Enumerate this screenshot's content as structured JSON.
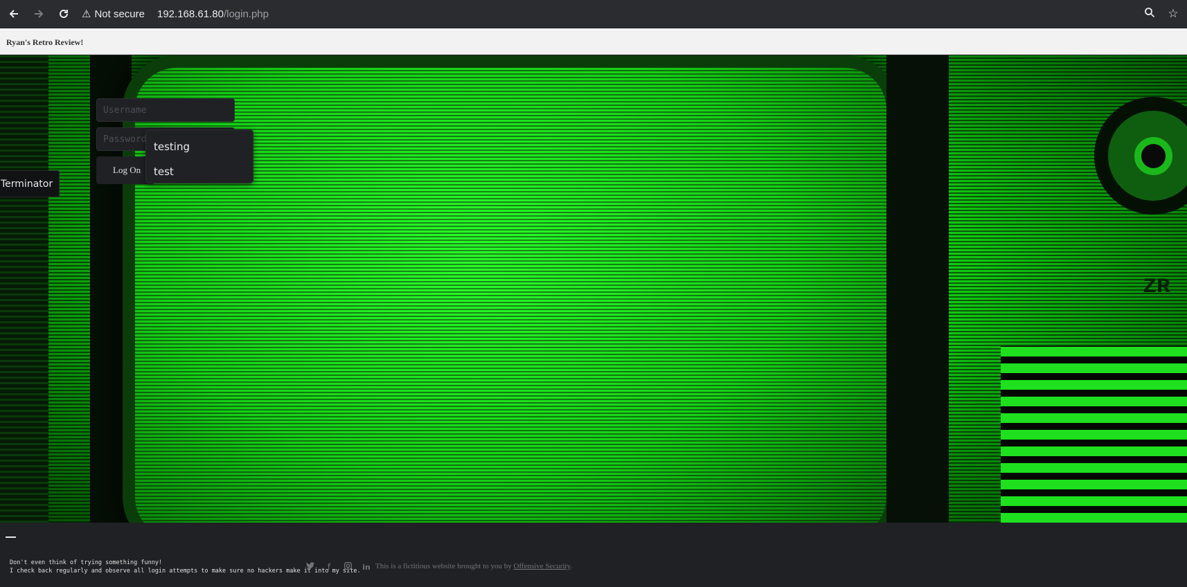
{
  "browser": {
    "security_label": "Not secure",
    "url_host": "192.168.61.80",
    "url_path": "/login.php"
  },
  "site": {
    "title": "Ryan's Retro Review!"
  },
  "login": {
    "username_placeholder": "Username",
    "password_placeholder": "Password",
    "logon_label": "Log On"
  },
  "autocomplete": {
    "items": [
      "testing",
      "test"
    ]
  },
  "label": {
    "terminator": "Terminator"
  },
  "footer": {
    "warning_line1": "Don't even think of trying something funny!",
    "warning_line2": "I check back regularly and observe all login attempts to make sure no hackers make it into my site.",
    "credit_text": "This is a fictitious website brought to you by ",
    "credit_link": "Offensive Security",
    "credit_end": ".",
    "social_icons": [
      "twitter-icon",
      "facebook-icon",
      "instagram-icon",
      "linkedin-icon"
    ]
  },
  "colors": {
    "hero_green": "#1ee01e",
    "footer_bg": "#202124",
    "chrome_bg": "#2b2c30"
  }
}
